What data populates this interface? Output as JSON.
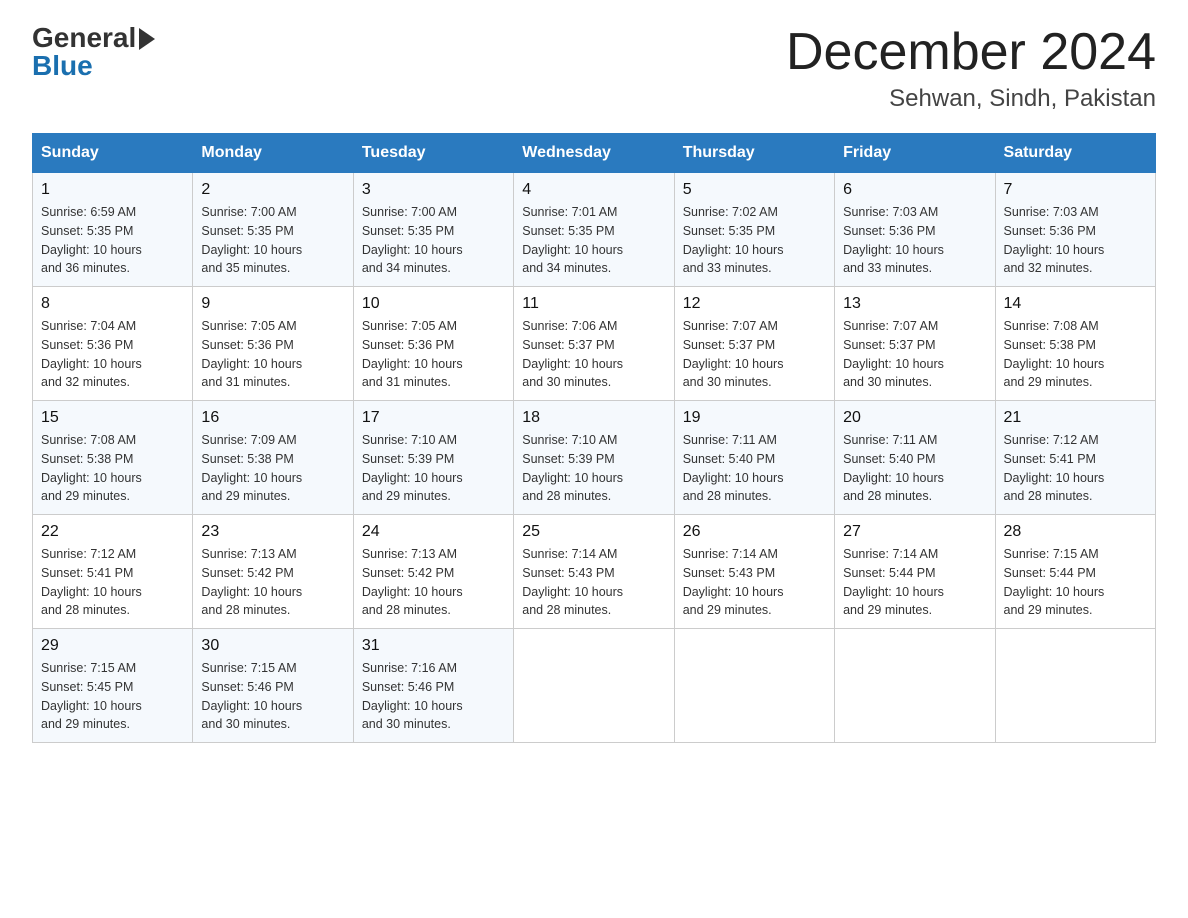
{
  "header": {
    "logo_general": "General",
    "logo_blue": "Blue",
    "month_title": "December 2024",
    "location": "Sehwan, Sindh, Pakistan"
  },
  "weekdays": [
    "Sunday",
    "Monday",
    "Tuesday",
    "Wednesday",
    "Thursday",
    "Friday",
    "Saturday"
  ],
  "weeks": [
    [
      {
        "day": "1",
        "sunrise": "6:59 AM",
        "sunset": "5:35 PM",
        "daylight": "10 hours and 36 minutes."
      },
      {
        "day": "2",
        "sunrise": "7:00 AM",
        "sunset": "5:35 PM",
        "daylight": "10 hours and 35 minutes."
      },
      {
        "day": "3",
        "sunrise": "7:00 AM",
        "sunset": "5:35 PM",
        "daylight": "10 hours and 34 minutes."
      },
      {
        "day": "4",
        "sunrise": "7:01 AM",
        "sunset": "5:35 PM",
        "daylight": "10 hours and 34 minutes."
      },
      {
        "day": "5",
        "sunrise": "7:02 AM",
        "sunset": "5:35 PM",
        "daylight": "10 hours and 33 minutes."
      },
      {
        "day": "6",
        "sunrise": "7:03 AM",
        "sunset": "5:36 PM",
        "daylight": "10 hours and 33 minutes."
      },
      {
        "day": "7",
        "sunrise": "7:03 AM",
        "sunset": "5:36 PM",
        "daylight": "10 hours and 32 minutes."
      }
    ],
    [
      {
        "day": "8",
        "sunrise": "7:04 AM",
        "sunset": "5:36 PM",
        "daylight": "10 hours and 32 minutes."
      },
      {
        "day": "9",
        "sunrise": "7:05 AM",
        "sunset": "5:36 PM",
        "daylight": "10 hours and 31 minutes."
      },
      {
        "day": "10",
        "sunrise": "7:05 AM",
        "sunset": "5:36 PM",
        "daylight": "10 hours and 31 minutes."
      },
      {
        "day": "11",
        "sunrise": "7:06 AM",
        "sunset": "5:37 PM",
        "daylight": "10 hours and 30 minutes."
      },
      {
        "day": "12",
        "sunrise": "7:07 AM",
        "sunset": "5:37 PM",
        "daylight": "10 hours and 30 minutes."
      },
      {
        "day": "13",
        "sunrise": "7:07 AM",
        "sunset": "5:37 PM",
        "daylight": "10 hours and 30 minutes."
      },
      {
        "day": "14",
        "sunrise": "7:08 AM",
        "sunset": "5:38 PM",
        "daylight": "10 hours and 29 minutes."
      }
    ],
    [
      {
        "day": "15",
        "sunrise": "7:08 AM",
        "sunset": "5:38 PM",
        "daylight": "10 hours and 29 minutes."
      },
      {
        "day": "16",
        "sunrise": "7:09 AM",
        "sunset": "5:38 PM",
        "daylight": "10 hours and 29 minutes."
      },
      {
        "day": "17",
        "sunrise": "7:10 AM",
        "sunset": "5:39 PM",
        "daylight": "10 hours and 29 minutes."
      },
      {
        "day": "18",
        "sunrise": "7:10 AM",
        "sunset": "5:39 PM",
        "daylight": "10 hours and 28 minutes."
      },
      {
        "day": "19",
        "sunrise": "7:11 AM",
        "sunset": "5:40 PM",
        "daylight": "10 hours and 28 minutes."
      },
      {
        "day": "20",
        "sunrise": "7:11 AM",
        "sunset": "5:40 PM",
        "daylight": "10 hours and 28 minutes."
      },
      {
        "day": "21",
        "sunrise": "7:12 AM",
        "sunset": "5:41 PM",
        "daylight": "10 hours and 28 minutes."
      }
    ],
    [
      {
        "day": "22",
        "sunrise": "7:12 AM",
        "sunset": "5:41 PM",
        "daylight": "10 hours and 28 minutes."
      },
      {
        "day": "23",
        "sunrise": "7:13 AM",
        "sunset": "5:42 PM",
        "daylight": "10 hours and 28 minutes."
      },
      {
        "day": "24",
        "sunrise": "7:13 AM",
        "sunset": "5:42 PM",
        "daylight": "10 hours and 28 minutes."
      },
      {
        "day": "25",
        "sunrise": "7:14 AM",
        "sunset": "5:43 PM",
        "daylight": "10 hours and 28 minutes."
      },
      {
        "day": "26",
        "sunrise": "7:14 AM",
        "sunset": "5:43 PM",
        "daylight": "10 hours and 29 minutes."
      },
      {
        "day": "27",
        "sunrise": "7:14 AM",
        "sunset": "5:44 PM",
        "daylight": "10 hours and 29 minutes."
      },
      {
        "day": "28",
        "sunrise": "7:15 AM",
        "sunset": "5:44 PM",
        "daylight": "10 hours and 29 minutes."
      }
    ],
    [
      {
        "day": "29",
        "sunrise": "7:15 AM",
        "sunset": "5:45 PM",
        "daylight": "10 hours and 29 minutes."
      },
      {
        "day": "30",
        "sunrise": "7:15 AM",
        "sunset": "5:46 PM",
        "daylight": "10 hours and 30 minutes."
      },
      {
        "day": "31",
        "sunrise": "7:16 AM",
        "sunset": "5:46 PM",
        "daylight": "10 hours and 30 minutes."
      },
      null,
      null,
      null,
      null
    ]
  ],
  "labels": {
    "sunrise": "Sunrise:",
    "sunset": "Sunset:",
    "daylight": "Daylight:"
  }
}
